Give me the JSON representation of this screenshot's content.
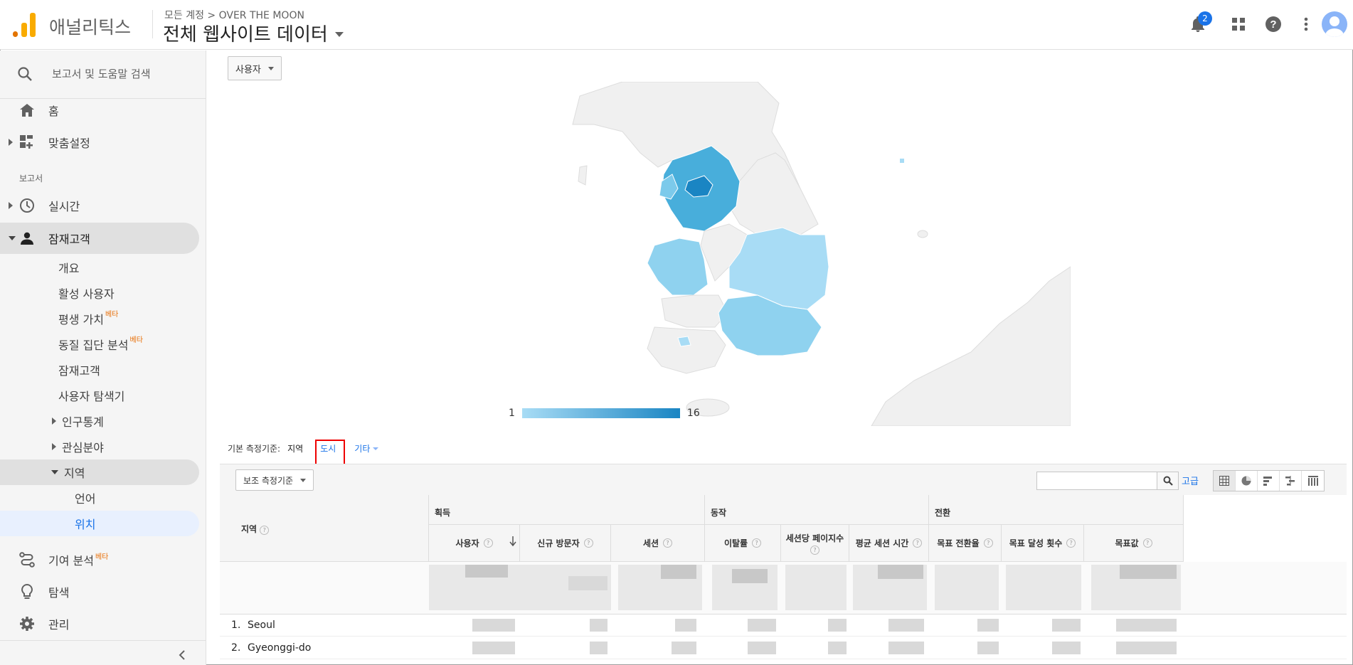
{
  "header": {
    "app_name": "애널리틱스",
    "breadcrumb": "모든 계정 > OVER THE MOON",
    "property_title": "전체 웹사이트 데이터",
    "notification_count": "2",
    "icons": [
      "bell-icon",
      "apps-grid-icon",
      "help-icon",
      "more-vert-icon",
      "account-avatar"
    ]
  },
  "sidebar": {
    "search_placeholder": "보고서 및 도움말 검색",
    "home": "홈",
    "customization": "맞춤설정",
    "reports_section": "보고서",
    "realtime": "실시간",
    "audience": "잠재고객",
    "audience_items": {
      "overview": "개요",
      "active_users": "활성 사용자",
      "lifetime_value": "평생 가치",
      "cohort": "동질 집단 분석",
      "audiences": "잠재고객",
      "user_explorer": "사용자 탐색기",
      "demographics": "인구통계",
      "interests": "관심분야",
      "geo": "지역",
      "language": "언어",
      "location": "위치"
    },
    "beta": "베타",
    "attribution": "기여 분석",
    "discover": "탐색",
    "admin": "관리"
  },
  "main": {
    "metric_selector": "사용자",
    "legend_min": "1",
    "legend_max": "16",
    "primary_dimension_label": "기본 측정기준:",
    "dimension_current": "지역",
    "dimension_city": "도시",
    "dimension_other": "기타",
    "secondary_dimension": "보조 측정기준",
    "advanced": "고급",
    "table": {
      "dim_header": "지역",
      "groups": [
        "획득",
        "동작",
        "전환"
      ],
      "columns": [
        "사용자",
        "신규 방문자",
        "세션",
        "이탈률",
        "세션당 페이지수",
        "평균 세션 시간",
        "목표 전환율",
        "목표 달성 횟수",
        "목표값"
      ],
      "rows": [
        {
          "idx": "1.",
          "name": "Seoul"
        },
        {
          "idx": "2.",
          "name": "Gyeonggi-do"
        }
      ]
    }
  },
  "colors": {
    "accent": "#1a73e8",
    "map_high": "#1a85c3",
    "map_low": "#a8dcf5",
    "highlight": "#ee0000",
    "logo_orange": "#f9ab00",
    "logo_dark_orange": "#e37400"
  }
}
